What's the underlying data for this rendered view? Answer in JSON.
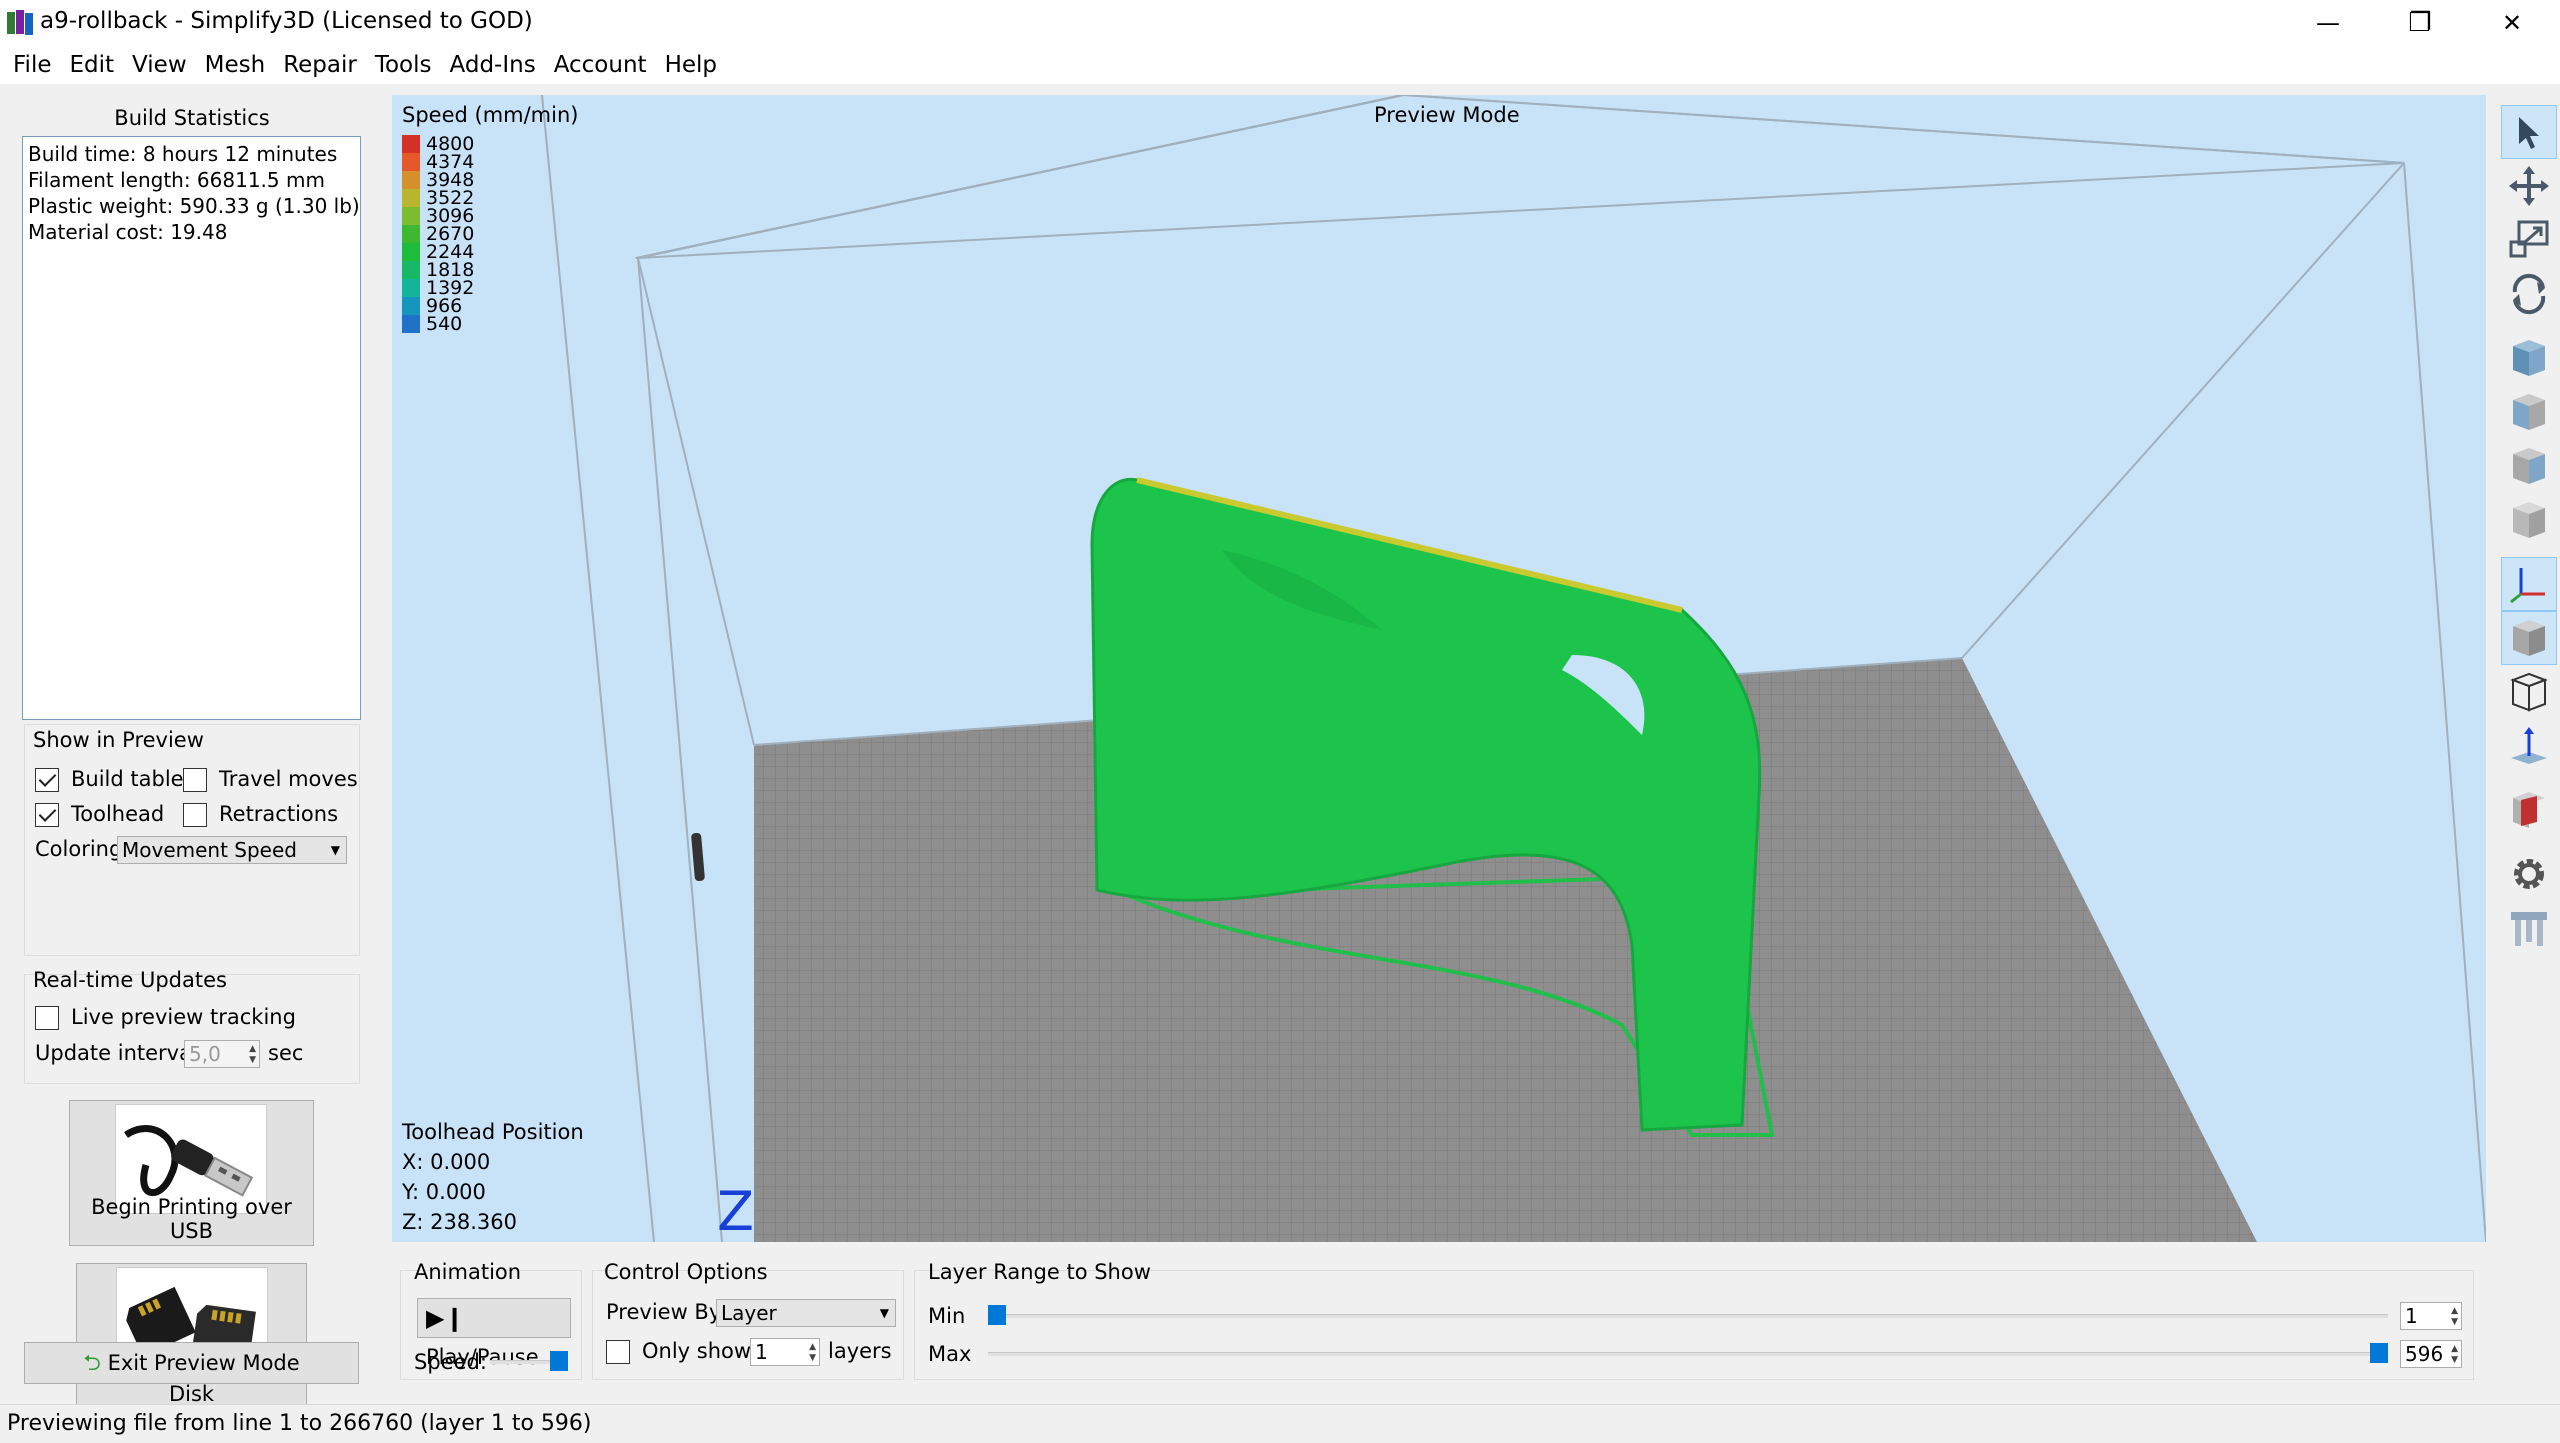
{
  "window": {
    "title": "a9-rollback - Simplify3D (Licensed to GOD)",
    "minimize": "—",
    "restore": "❐",
    "close": "✕"
  },
  "menu": [
    "File",
    "Edit",
    "View",
    "Mesh",
    "Repair",
    "Tools",
    "Add-Ins",
    "Account",
    "Help"
  ],
  "build_stats": {
    "title": "Build Statistics",
    "lines": [
      "Build time: 8 hours 12 minutes",
      "Filament length: 66811.5 mm",
      "Plastic weight: 590.33 g (1.30 lb)",
      "Material cost: 19.48"
    ]
  },
  "show_in_preview": {
    "title": "Show in Preview",
    "build_table": {
      "label": "Build table",
      "checked": true
    },
    "travel_moves": {
      "label": "Travel moves",
      "checked": false
    },
    "toolhead": {
      "label": "Toolhead",
      "checked": true
    },
    "retractions": {
      "label": "Retractions",
      "checked": false
    },
    "coloring_label": "Coloring",
    "coloring_value": "Movement Speed"
  },
  "realtime": {
    "title": "Real-time Updates",
    "live_label": "Live preview tracking",
    "interval_label": "Update interval",
    "interval_value": "5,0",
    "interval_unit": "sec"
  },
  "buttons": {
    "usb": "Begin Printing over USB",
    "disk": "Save Toolpaths to Disk",
    "exit": "Exit Preview Mode"
  },
  "viewport": {
    "mode": "Preview Mode",
    "legend_title": "Speed (mm/min)",
    "legend": [
      {
        "value": "4800",
        "color": "#d73027"
      },
      {
        "value": "4374",
        "color": "#e4582a"
      },
      {
        "value": "3948",
        "color": "#d5902b"
      },
      {
        "value": "3522",
        "color": "#b8b62f"
      },
      {
        "value": "3096",
        "color": "#7dbb30"
      },
      {
        "value": "2670",
        "color": "#3fb831"
      },
      {
        "value": "2244",
        "color": "#1ebc3d"
      },
      {
        "value": "1818",
        "color": "#17b868"
      },
      {
        "value": "1392",
        "color": "#15b59a"
      },
      {
        "value": "966",
        "color": "#1695bd"
      },
      {
        "value": "540",
        "color": "#2172c7"
      }
    ],
    "toolhead_title": "Toolhead Position",
    "x": "X: 0.000",
    "y": "Y: 0.000",
    "z": "Z: 238.360",
    "axis_label": "Z"
  },
  "animation": {
    "title": "Animation",
    "play_label": "Play/Pause",
    "speed_label": "Speed:",
    "speed_fraction": 1.0
  },
  "control": {
    "title": "Control Options",
    "preview_by_label": "Preview By",
    "preview_by_value": "Layer",
    "only_show_label": "Only show",
    "only_show_value": "1",
    "layers_label": "layers"
  },
  "layer_range": {
    "title": "Layer Range to Show",
    "min_label": "Min",
    "min_value": "1",
    "max_label": "Max",
    "max_value": "596",
    "total_layers": 596
  },
  "status": "Previewing file from line 1 to 266760 (layer 1 to 596)"
}
